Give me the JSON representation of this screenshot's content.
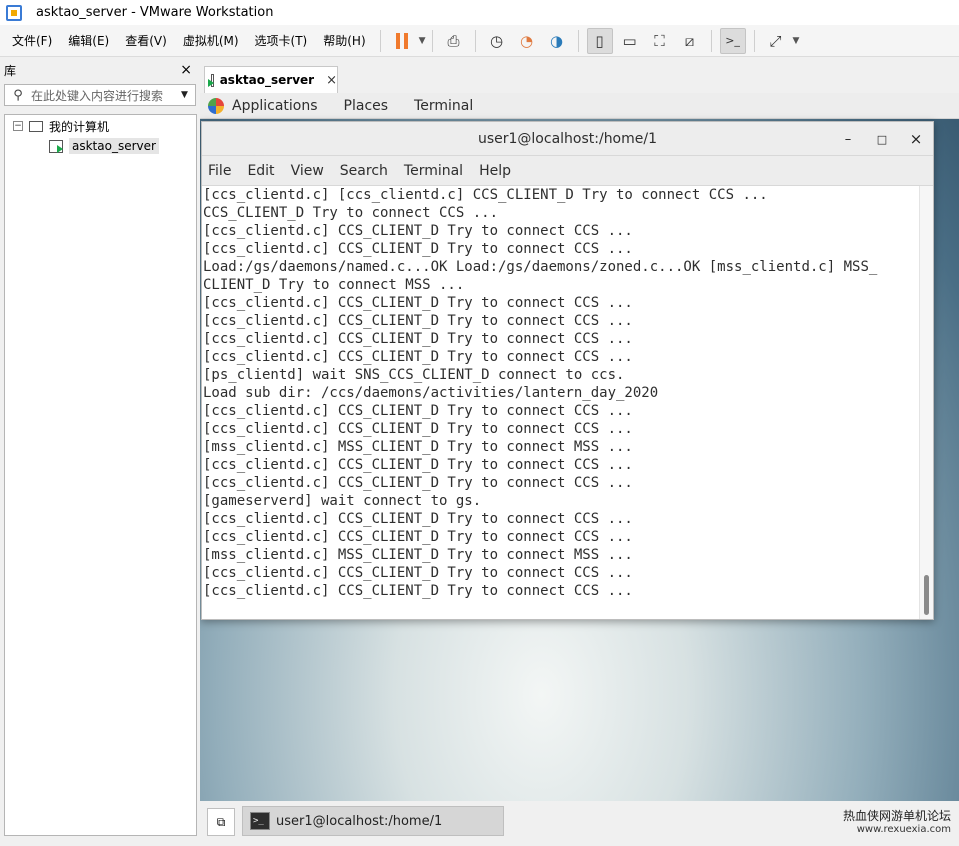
{
  "window": {
    "title": "asktao_server - VMware Workstation"
  },
  "menu": [
    "文件(F)",
    "编辑(E)",
    "查看(V)",
    "虚拟机(M)",
    "选项卡(T)",
    "帮助(H)"
  ],
  "library": {
    "title": "库",
    "close": "×",
    "search_placeholder": "在此处键入内容进行搜索",
    "tree": {
      "root": "我的计算机",
      "vm": "asktao_server"
    }
  },
  "tab": {
    "label": "asktao_server",
    "close": "×"
  },
  "guest": {
    "topbar": [
      "Applications",
      "Places",
      "Terminal"
    ],
    "terminal": {
      "title": "user1@localhost:/home/1",
      "controls": [
        "–",
        "□",
        "×"
      ],
      "menu": [
        "File",
        "Edit",
        "View",
        "Search",
        "Terminal",
        "Help"
      ],
      "lines": [
        "[ccs_clientd.c] [ccs_clientd.c] CCS_CLIENT_D Try to connect CCS ...",
        "CCS_CLIENT_D Try to connect CCS ...",
        "[ccs_clientd.c] CCS_CLIENT_D Try to connect CCS ...",
        "[ccs_clientd.c] CCS_CLIENT_D Try to connect CCS ...",
        "Load:/gs/daemons/named.c...OK Load:/gs/daemons/zoned.c...OK [mss_clientd.c] MSS_",
        "CLIENT_D Try to connect MSS ...",
        "[ccs_clientd.c] CCS_CLIENT_D Try to connect CCS ...",
        "[ccs_clientd.c] CCS_CLIENT_D Try to connect CCS ...",
        "[ccs_clientd.c] CCS_CLIENT_D Try to connect CCS ...",
        "[ccs_clientd.c] CCS_CLIENT_D Try to connect CCS ...",
        "[ps_clientd] wait SNS_CCS_CLIENT_D connect to ccs.",
        "Load sub dir: /ccs/daemons/activities/lantern_day_2020",
        "[ccs_clientd.c] CCS_CLIENT_D Try to connect CCS ...",
        "[ccs_clientd.c] CCS_CLIENT_D Try to connect CCS ...",
        "[mss_clientd.c] MSS_CLIENT_D Try to connect MSS ...",
        "[ccs_clientd.c] CCS_CLIENT_D Try to connect CCS ...",
        "[ccs_clientd.c] CCS_CLIENT_D Try to connect CCS ...",
        "[gameserverd] wait connect to gs.",
        "[ccs_clientd.c] CCS_CLIENT_D Try to connect CCS ...",
        "[ccs_clientd.c] CCS_CLIENT_D Try to connect CCS ...",
        "[mss_clientd.c] MSS_CLIENT_D Try to connect MSS ...",
        "[ccs_clientd.c] CCS_CLIENT_D Try to connect CCS ...",
        "[ccs_clientd.c] CCS_CLIENT_D Try to connect CCS ..."
      ]
    },
    "taskbar_item": "user1@localhost:/home/1"
  },
  "footer": {
    "forum_name": "热血侠网游单机论坛",
    "forum_url": "www.rexuexia.com"
  },
  "icons": [
    "vmware-icon",
    "pause-icon",
    "send-ctrl-alt-del-icon",
    "snapshot-icon",
    "revert-snapshot-icon",
    "snapshot-manager-icon",
    "show-library-icon",
    "thumbnail-bar-icon",
    "full-screen-icon",
    "unity-icon",
    "console-view-icon",
    "stretch-icon"
  ],
  "colors": {
    "accent": "#f07a2d",
    "terminal_bg": "#ffffff",
    "terminal_fg": "#2e2e2e"
  }
}
